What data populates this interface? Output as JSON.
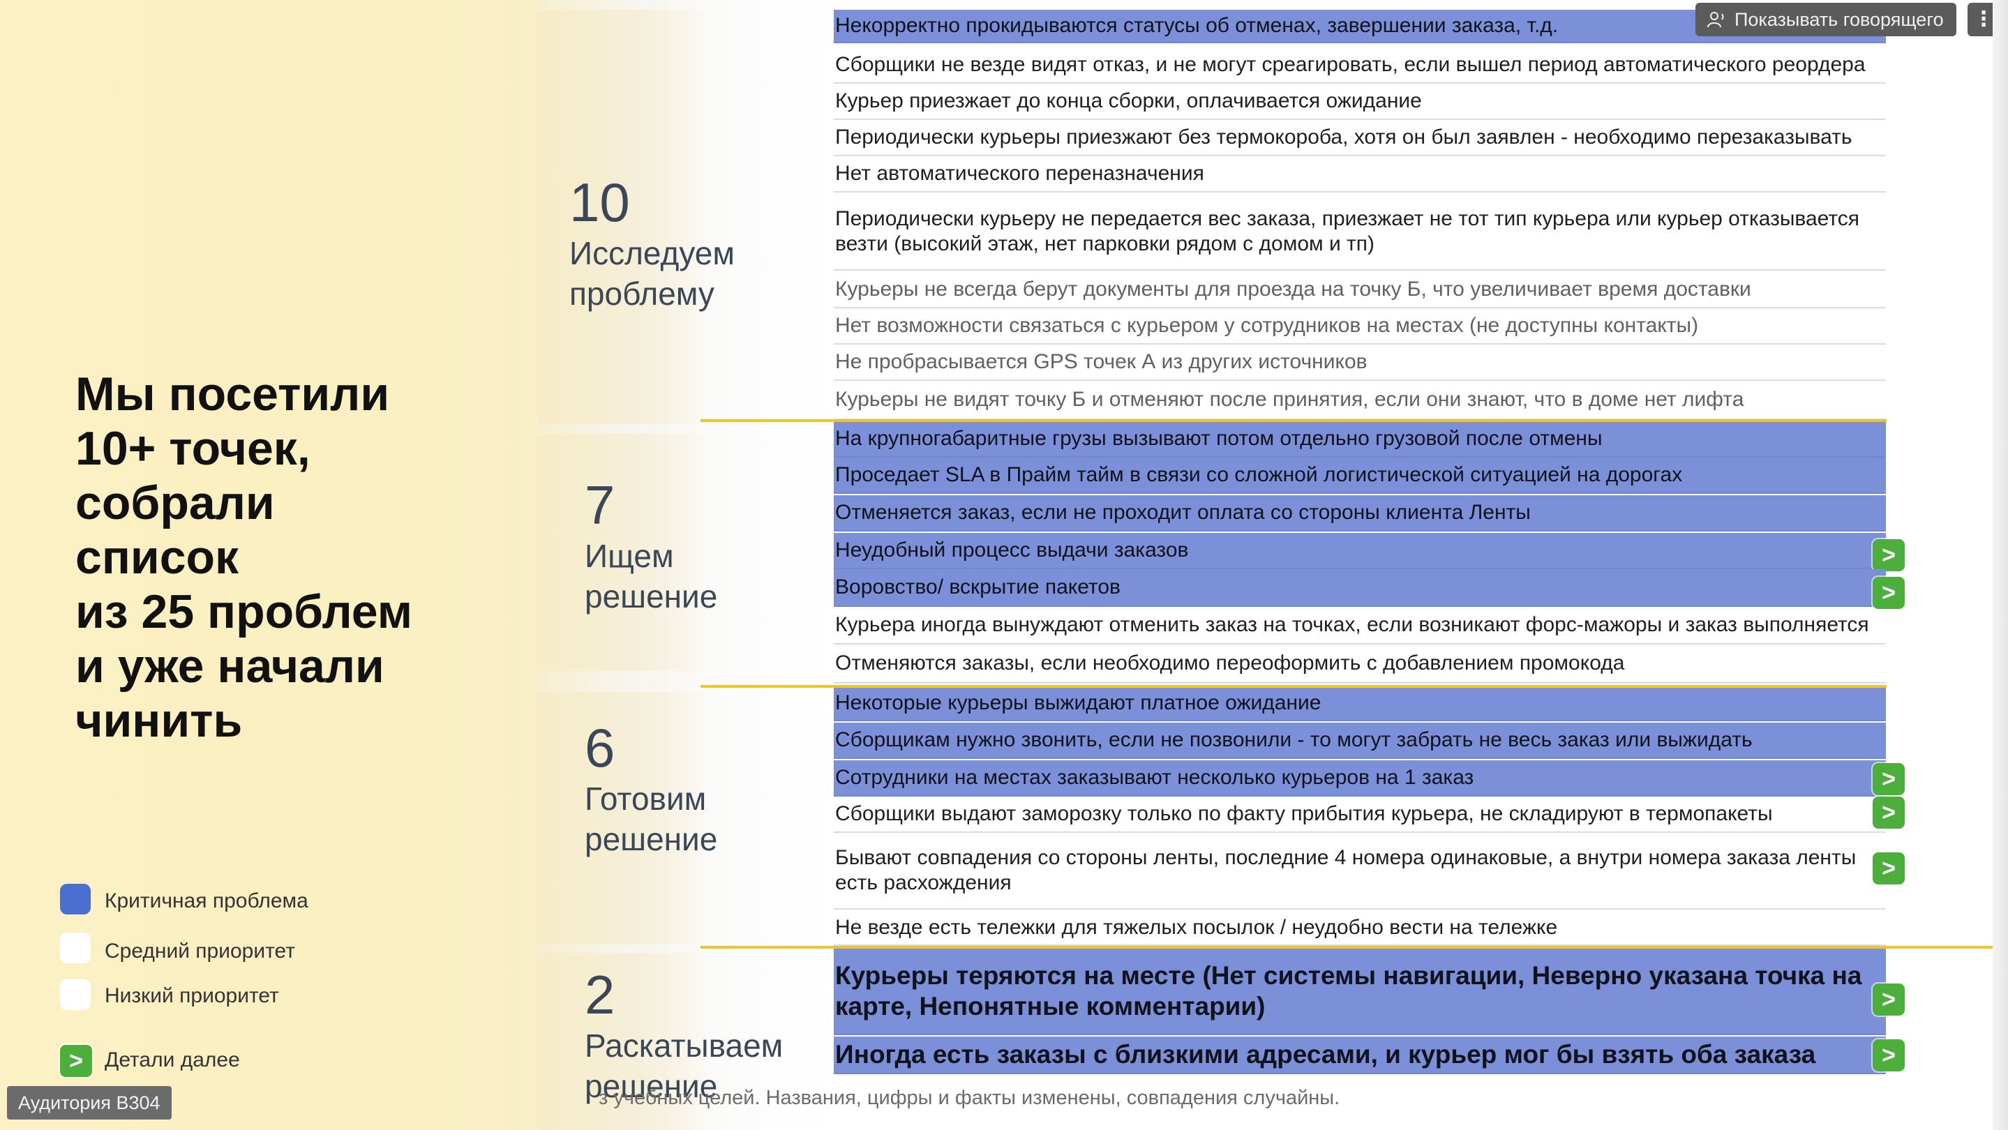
{
  "overlay": {
    "show_speaker_label": "Показывать говорящего",
    "more_label": "⋮",
    "room_label": "Аудитория B304"
  },
  "headline": "Мы посетили\n10+ точек,\nсобрали\nсписок\nиз 25 проблем\nи уже начали\nчинить",
  "stages": [
    {
      "number": "10",
      "label": "Исследуем\nпроблему"
    },
    {
      "number": "7",
      "label": "Ищем\nрешение"
    },
    {
      "number": "6",
      "label": "Готовим\nрешение"
    },
    {
      "number": "2",
      "label": "Раскатываем\nрешение"
    }
  ],
  "problems": [
    {
      "text": "Некорректно прокидываются статусы об отменах, завершении заказа, т.д.",
      "priority": "critical",
      "details": false
    },
    {
      "text": "Сборщики не везде видят отказ, и не могут среагировать, если вышел период автоматического реордера",
      "priority": "medium",
      "details": false
    },
    {
      "text": "Курьер приезжает до конца сборки, оплачивается ожидание",
      "priority": "medium",
      "details": false
    },
    {
      "text": "Периодически курьеры приезжают без термокороба, хотя он был заявлен - необходимо перезаказывать",
      "priority": "medium",
      "details": false
    },
    {
      "text": "Нет автоматического переназначения",
      "priority": "medium",
      "details": false
    },
    {
      "text": "Периодически курьеру не передается вес заказа, приезжает не тот тип курьера или курьер отказывается везти (высокий этаж, нет парковки рядом с домом и тп)",
      "priority": "medium",
      "details": false
    },
    {
      "text": "Курьеры не всегда берут документы для проезда на точку Б, что увеличивает время доставки",
      "priority": "low",
      "details": false
    },
    {
      "text": "Нет возможности связаться с курьером у сотрудников на местах (не доступны контакты)",
      "priority": "low",
      "details": false
    },
    {
      "text": "Не пробрасывается GPS точек А из других источников",
      "priority": "low",
      "details": false
    },
    {
      "text": "Курьеры не видят точку Б и отменяют после принятия, если они знают, что в доме нет лифта",
      "priority": "low",
      "details": false
    },
    {
      "text": "На крупногабаритные грузы вызывают потом отдельно грузовой после отмены",
      "priority": "critical",
      "details": false
    },
    {
      "text": "Проседает SLA в Прайм тайм в связи со сложной логистической ситуацией на дорогах",
      "priority": "critical",
      "details": false
    },
    {
      "text": "Отменяется заказ, если не проходит оплата со стороны клиента Ленты",
      "priority": "critical",
      "details": false
    },
    {
      "text": "Неудобный процесс выдачи заказов",
      "priority": "critical",
      "details": true
    },
    {
      "text": "Воровство/ вскрытие пакетов",
      "priority": "critical",
      "details": true
    },
    {
      "text": "Курьера иногда вынуждают отменить заказ на точках, если возникают форс-мажоры и заказ выполняется",
      "priority": "medium",
      "details": false
    },
    {
      "text": "Отменяются заказы, если необходимо переоформить с добавлением промокода",
      "priority": "medium",
      "details": false
    },
    {
      "text": "Некоторые курьеры выжидают платное ожидание",
      "priority": "critical",
      "details": false
    },
    {
      "text": "Сборщикам нужно звонить, если не позвонили - то могут забрать не весь заказ или выжидать",
      "priority": "critical",
      "details": false
    },
    {
      "text": "Сотрудники на местах заказывают несколько курьеров на 1 заказ",
      "priority": "critical",
      "details": true
    },
    {
      "text": "Сборщики выдают заморозку только по факту прибытия курьера, не складируют в термопакеты",
      "priority": "medium",
      "details": true
    },
    {
      "text": "Бывают совпадения со стороны ленты, последние 4 номера одинаковые, а внутри номера заказа ленты есть расхождения",
      "priority": "medium",
      "details": true
    },
    {
      "text": "Не везде есть тележки для тяжелых посылок / неудобно вести на тележке",
      "priority": "medium",
      "details": false
    },
    {
      "text": "Курьеры теряются на месте (Нет системы навигации, Неверно указана точка на карте, Непонятные комментарии)",
      "priority": "critical",
      "details": true
    },
    {
      "text": "Иногда есть заказы с близкими адресами, и курьер мог бы взять оба заказа",
      "priority": "critical",
      "details": true
    }
  ],
  "details_glyph": ">",
  "legend": {
    "critical": "Критичная проблема",
    "medium": "Средний приоритет",
    "low": "Низкий приоритет",
    "details": "Детали далее",
    "details_glyph": ">"
  },
  "colors": {
    "critical": "#7b90d8",
    "separator": "#efc52f",
    "details_button": "#4caf3c",
    "left_panel": "#fcf1c4"
  },
  "footer_note": "з учебных целей. Названия, цифры и факты изменены, совпадения случайны."
}
